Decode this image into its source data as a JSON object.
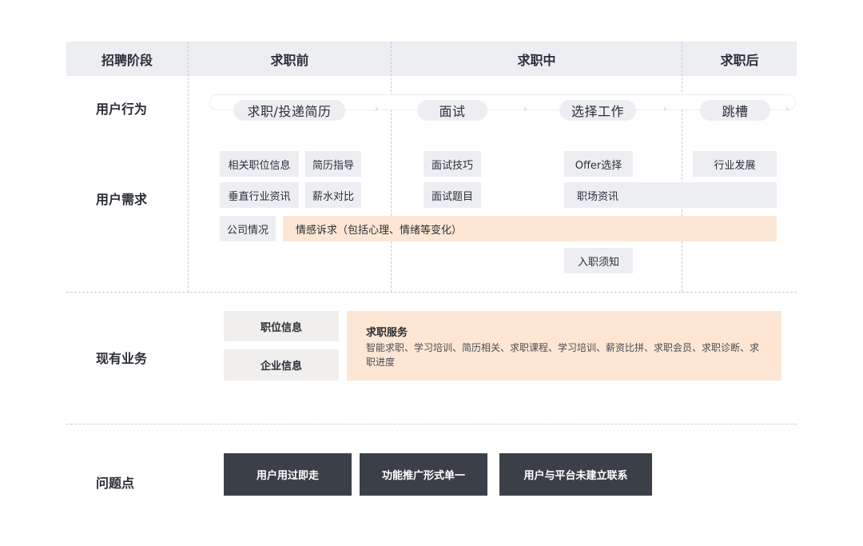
{
  "header": {
    "stage_label": "招聘阶段",
    "before": "求职前",
    "during": "求职中",
    "after": "求职后"
  },
  "rows": {
    "behavior": "用户行为",
    "needs": "用户需求",
    "business": "现有业务",
    "problems": "问题点"
  },
  "journey": {
    "steps": [
      "求职/投递简历",
      "面试",
      "选择工作",
      "跳槽"
    ]
  },
  "needs": {
    "related_jobs": "相关职位信息",
    "resume_guide": "简历指导",
    "vertical_news": "垂直行业资讯",
    "salary_compare": "薪水对比",
    "company_info": "公司情况",
    "emotional": "情感诉求（包括心理、情绪等变化）",
    "interview_skills": "面试技巧",
    "interview_questions": "面试题目",
    "offer_choice": "Offer选择",
    "workplace_news": "职场资讯",
    "onboarding": "入职须知",
    "career_dev": "行业发展"
  },
  "business": {
    "job_info": "职位信息",
    "company_info": "企业信息",
    "service_title": "求职服务",
    "service_desc": "智能求职、学习培训、简历相关、求职课程、学习培训、薪资比拼、求职会员、求职诊断、求职进度"
  },
  "problems": {
    "p1": "用户用过即走",
    "p2": "功能推广形式单一",
    "p3": "用户与平台未建立联系"
  }
}
